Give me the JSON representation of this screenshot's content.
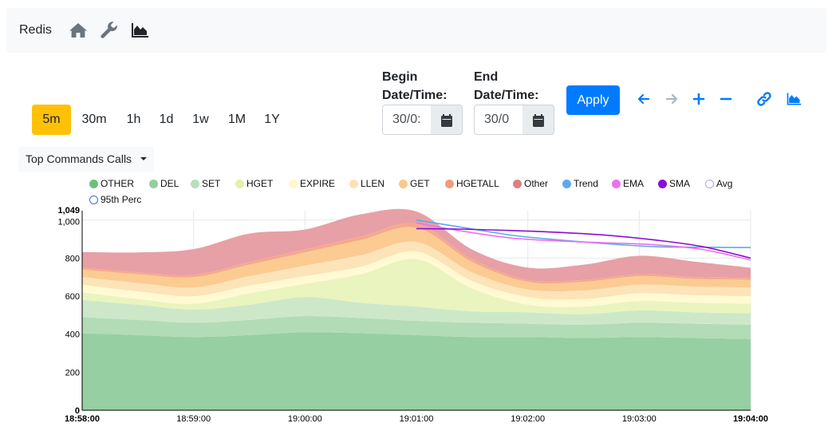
{
  "navbar": {
    "brand": "Redis",
    "icons": [
      "home-icon",
      "wrench-icon",
      "area-chart-icon"
    ]
  },
  "time_ranges": [
    {
      "label": "5m",
      "active": true
    },
    {
      "label": "30m",
      "active": false
    },
    {
      "label": "1h",
      "active": false
    },
    {
      "label": "1d",
      "active": false
    },
    {
      "label": "1w",
      "active": false
    },
    {
      "label": "1M",
      "active": false
    },
    {
      "label": "1Y",
      "active": false
    }
  ],
  "begin": {
    "label_line1": "Begin",
    "label_line2": "Date/Time:",
    "value": "30/0:"
  },
  "end": {
    "label_line1": "End",
    "label_line2": "Date/Time:",
    "value": "30/0"
  },
  "apply_label": "Apply",
  "toolbar_icons": [
    "arrow-left-icon",
    "arrow-right-icon",
    "zoom-in-icon",
    "zoom-out-icon",
    "link-icon",
    "area-chart-icon"
  ],
  "dropdown": {
    "label": "Top Commands Calls"
  },
  "colors": {
    "accent": "#007bff",
    "active_range": "#ffc107"
  },
  "chart_data": {
    "type": "area",
    "stacked": true,
    "x": [
      "18:58:00",
      "18:58:30",
      "18:59:00",
      "18:59:30",
      "19:00:00",
      "19:00:30",
      "19:01:00",
      "19:01:30",
      "19:02:00",
      "19:02:30",
      "19:03:00",
      "19:03:30",
      "19:04:00"
    ],
    "x_ticks": [
      "18:58:00",
      "18:59:00",
      "19:00:00",
      "19:01:00",
      "19:02:00",
      "19:03:00",
      "19:04:00"
    ],
    "y_ticks": [
      0,
      200,
      400,
      600,
      800,
      "1,000",
      "1,049"
    ],
    "ylim": [
      0,
      1049
    ],
    "grid": true,
    "legend_position": "top",
    "series": [
      {
        "name": "OTHER",
        "color": "#6fbf7b",
        "fill": "#95cfa2",
        "values": [
          405,
          395,
          385,
          395,
          410,
          405,
          395,
          385,
          385,
          380,
          385,
          380,
          375
        ]
      },
      {
        "name": "DEL",
        "color": "#90d09a",
        "fill": "#b2dcb5",
        "values": [
          85,
          80,
          75,
          80,
          85,
          80,
          75,
          75,
          70,
          70,
          75,
          75,
          75
        ]
      },
      {
        "name": "SET",
        "color": "#b5e1b8",
        "fill": "#cde8c9",
        "values": [
          90,
          80,
          70,
          80,
          100,
          80,
          75,
          60,
          60,
          55,
          65,
          60,
          60
        ]
      },
      {
        "name": "HGET",
        "color": "#e4f1ab",
        "fill": "#eaf4bf",
        "values": [
          40,
          30,
          30,
          60,
          70,
          150,
          250,
          120,
          40,
          40,
          50,
          50,
          50
        ]
      },
      {
        "name": "EXPIRE",
        "color": "#fff9c8",
        "fill": "#fffad1",
        "values": [
          40,
          40,
          40,
          40,
          40,
          40,
          40,
          40,
          40,
          40,
          40,
          40,
          40
        ]
      },
      {
        "name": "LLEN",
        "color": "#fde1b3",
        "fill": "#fde3b8",
        "values": [
          40,
          45,
          45,
          50,
          55,
          60,
          50,
          45,
          40,
          45,
          45,
          45,
          45
        ]
      },
      {
        "name": "GET",
        "color": "#fbc78b",
        "fill": "#fbcb92",
        "values": [
          40,
          45,
          55,
          60,
          70,
          80,
          75,
          55,
          40,
          45,
          45,
          40,
          40
        ]
      },
      {
        "name": "HGETALL",
        "color": "#f79a7a",
        "fill": "#f6a98c",
        "values": [
          10,
          10,
          12,
          14,
          16,
          18,
          20,
          14,
          10,
          10,
          10,
          10,
          10
        ]
      },
      {
        "name": "Other",
        "color": "#e17d85",
        "fill": "#e7a0a5",
        "values": [
          82,
          105,
          135,
          150,
          104,
          117,
          65,
          51,
          65,
          80,
          97,
          81,
          54
        ]
      }
    ],
    "lines": [
      {
        "name": "Trend",
        "color": "#5ea8ef",
        "x_from": "19:01:00",
        "values": [
          1000,
          960,
          920,
          895,
          875,
          860,
          857,
          855
        ]
      },
      {
        "name": "EMA",
        "color": "#ee6fee",
        "x_from": "19:01:00",
        "values": [
          985,
          940,
          905,
          890,
          880,
          870,
          845,
          790
        ]
      },
      {
        "name": "SMA",
        "color": "#8a0ed6",
        "x_from": "19:01:00",
        "values": [
          955,
          952,
          945,
          935,
          920,
          895,
          860,
          800
        ]
      }
    ],
    "legend": [
      {
        "name": "OTHER",
        "color": "#6fbf7b",
        "hollow": false
      },
      {
        "name": "DEL",
        "color": "#90d09a",
        "hollow": false
      },
      {
        "name": "SET",
        "color": "#b5e1b8",
        "hollow": false
      },
      {
        "name": "HGET",
        "color": "#e4f1ab",
        "hollow": false
      },
      {
        "name": "EXPIRE",
        "color": "#fff9c8",
        "hollow": false
      },
      {
        "name": "LLEN",
        "color": "#fde1b3",
        "hollow": false
      },
      {
        "name": "GET",
        "color": "#fbc78b",
        "hollow": false
      },
      {
        "name": "HGETALL",
        "color": "#f79a7a",
        "hollow": false
      },
      {
        "name": "Other",
        "color": "#e17d85",
        "hollow": false
      },
      {
        "name": "Trend",
        "color": "#5ea8ef",
        "hollow": false
      },
      {
        "name": "EMA",
        "color": "#ee6fee",
        "hollow": false
      },
      {
        "name": "SMA",
        "color": "#8a0ed6",
        "hollow": false
      },
      {
        "name": "Avg",
        "color": "#b8a6e0",
        "hollow": true
      },
      {
        "name": "95th Perc",
        "color": "#3a6ee0",
        "hollow": true
      }
    ]
  }
}
